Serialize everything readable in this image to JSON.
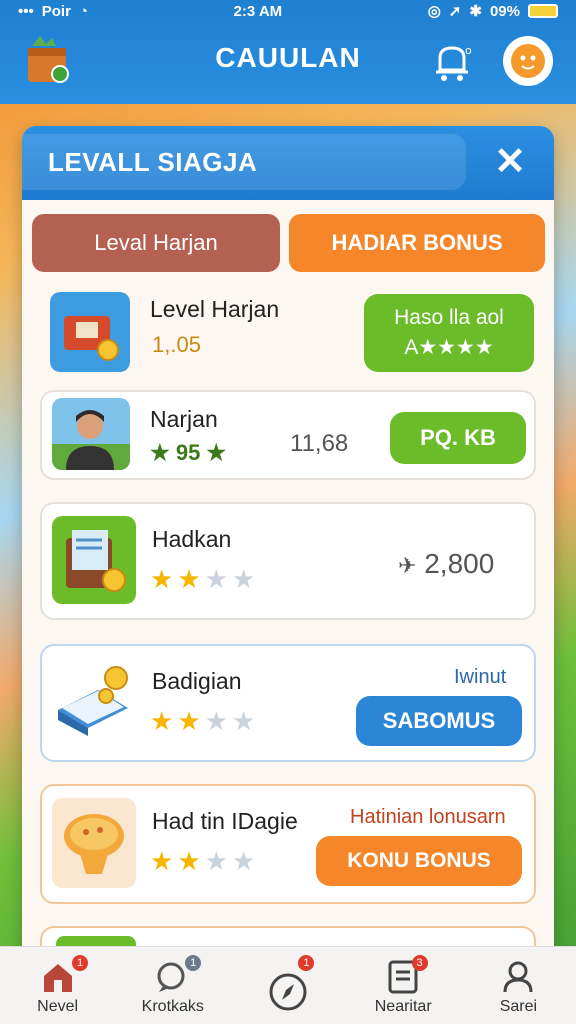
{
  "status_bar": {
    "carrier": "Poir",
    "time": "2:3 AM",
    "battery": "09%"
  },
  "header": {
    "title": "CAUULAN"
  },
  "modal": {
    "title": "LEVALL SIAGJA",
    "tabs": [
      {
        "label": "Leval Harjan",
        "active": true
      },
      {
        "label": "HADIAR BONUS",
        "active": false
      }
    ]
  },
  "rows": [
    {
      "name": "Level Harjan",
      "sub": "1,.05",
      "button": "Haso lla aol\nA★★★★",
      "icon": "treasure-chest-icon"
    },
    {
      "name": "Narjan",
      "score": "★ 95 ★",
      "value": "11,68",
      "button": "PQ. KB",
      "icon": "player-avatar-icon"
    },
    {
      "name": "Hadkan",
      "stars_filled": 2,
      "stars_total": 4,
      "value": "2,800",
      "icon": "document-coin-icon"
    },
    {
      "name": "Badigian",
      "stars_filled": 2,
      "stars_total": 4,
      "label": "Iwinut",
      "button": "SABOMUS",
      "icon": "book-coin-icon"
    },
    {
      "name": "Had tin IDagie",
      "stars_filled": 2,
      "stars_total": 4,
      "label": "Hatinian lonusarn",
      "button": "KONU BONUS",
      "icon": "pizza-trophy-icon"
    }
  ],
  "nav": [
    {
      "label": "Nevel",
      "icon": "home-icon",
      "badge": "1"
    },
    {
      "label": "Krotkaks",
      "icon": "chat-icon",
      "badge": "1"
    },
    {
      "label": "",
      "icon": "compass-icon",
      "badge": "1"
    },
    {
      "label": "Nearitar",
      "icon": "clipboard-icon",
      "badge": "3"
    },
    {
      "label": "Sarei",
      "icon": "profile-icon",
      "badge": ""
    }
  ],
  "colors": {
    "header_blue": "#1f7fd1",
    "green_button": "#6cbc2a",
    "blue_button": "#2c86d8",
    "orange_button": "#f5872a",
    "star": "#f7b500"
  }
}
